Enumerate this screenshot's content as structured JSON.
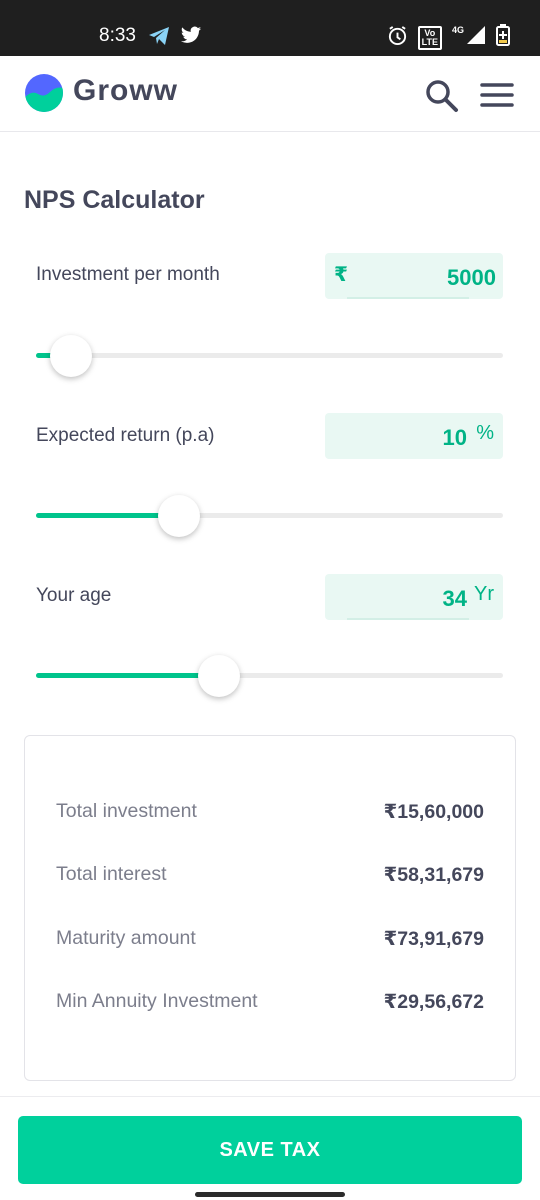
{
  "status_bar": {
    "time": "8:33",
    "lte_top": "Vo",
    "lte_bottom": "LTE",
    "network": "4G"
  },
  "app": {
    "brand": "Groww"
  },
  "calculator": {
    "title": "NPS Calculator",
    "investment": {
      "label": "Investment per month",
      "prefix": "₹",
      "value": "5000",
      "slider_fraction": 0.075
    },
    "return_rate": {
      "label": "Expected return (p.a)",
      "value": "10",
      "suffix": "%",
      "slider_fraction": 0.307
    },
    "age": {
      "label": "Your age",
      "value": "34",
      "suffix": "Yr",
      "slider_fraction": 0.391
    }
  },
  "results": [
    {
      "label": "Total investment",
      "value": "₹15,60,000"
    },
    {
      "label": "Total interest",
      "value": "₹58,31,679"
    },
    {
      "label": "Maturity amount",
      "value": "₹73,91,679"
    },
    {
      "label": "Min Annuity Investment",
      "value": "₹29,56,672"
    }
  ],
  "cta": {
    "label": "SAVE TAX"
  },
  "colors": {
    "accent": "#00d09c",
    "accent_text": "#00b386",
    "field_bg": "#e9f8f3",
    "slider_fill": "#00c48c"
  }
}
